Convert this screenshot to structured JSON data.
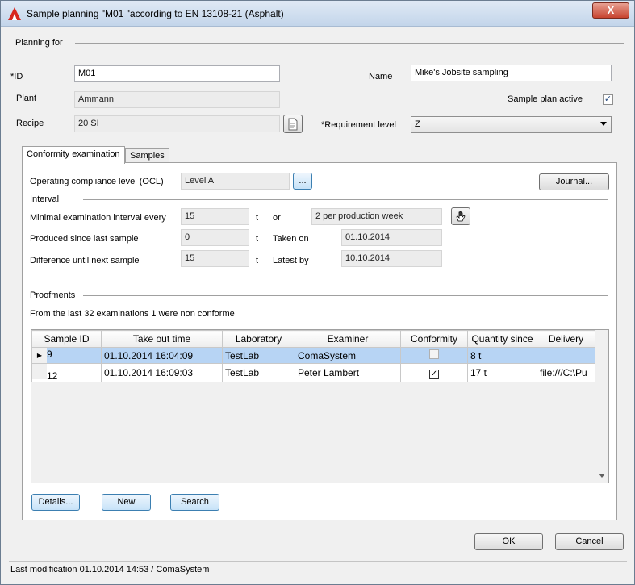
{
  "window": {
    "title": "Sample planning \"M01 \"according to EN 13108-21 (Asphalt)",
    "close_label": "X"
  },
  "planning": {
    "section_label": "Planning for",
    "id_label": "*ID",
    "id_value": "M01",
    "name_label": "Name",
    "name_value": "Mike's Jobsite sampling",
    "plant_label": "Plant",
    "plant_value": "Ammann",
    "active_label": "Sample plan active",
    "active_check": "✓",
    "recipe_label": "Recipe",
    "recipe_value": "20 SI",
    "req_label": "*Requirement level",
    "req_value": "Z"
  },
  "tabs": [
    {
      "label": "Conformity examination"
    },
    {
      "label": "Samples"
    }
  ],
  "conformity": {
    "ocl_label": "Operating compliance level (OCL)",
    "ocl_value": "Level A",
    "ocl_btn": "...",
    "journal_btn": "Journal...",
    "interval_label": "Interval",
    "min_label": "Minimal examination interval every",
    "min_value": "15",
    "min_unit": "t",
    "or_label": "or",
    "per_value": "2 per production week",
    "produced_label": "Produced since last sample",
    "produced_value": "0",
    "produced_unit": "t",
    "taken_label": "Taken on",
    "taken_value": "01.10.2014",
    "diff_label": "Difference until next sample",
    "diff_value": "15",
    "diff_unit": "t",
    "latest_label": "Latest by",
    "latest_value": "10.10.2014",
    "proof_label": "Proofments",
    "summary": "From the last 32 examinations 1 were non conforme"
  },
  "grid": {
    "columns": [
      "Sample ID",
      "Take out time",
      "Laboratory",
      "Examiner",
      "Conformity",
      "Quantity since",
      "Delivery"
    ],
    "rows": [
      {
        "marker": "▶",
        "id": "9",
        "time": "01.10.2014 16:04:09",
        "lab": "TestLab",
        "examiner": "ComaSystem",
        "conf": "",
        "qty": "8 t",
        "delivery": ""
      },
      {
        "marker": "",
        "id": "12",
        "time": "01.10.2014 16:09:03",
        "lab": "TestLab",
        "examiner": "Peter Lambert",
        "conf": "✓",
        "qty": "17 t",
        "delivery": "file:///C:\\Pu"
      }
    ]
  },
  "buttons": {
    "details": "Details...",
    "new": "New",
    "search": "Search",
    "ok": "OK",
    "cancel": "Cancel"
  },
  "status": {
    "text": "Last modification 01.10.2014 14:53 / ComaSystem"
  }
}
